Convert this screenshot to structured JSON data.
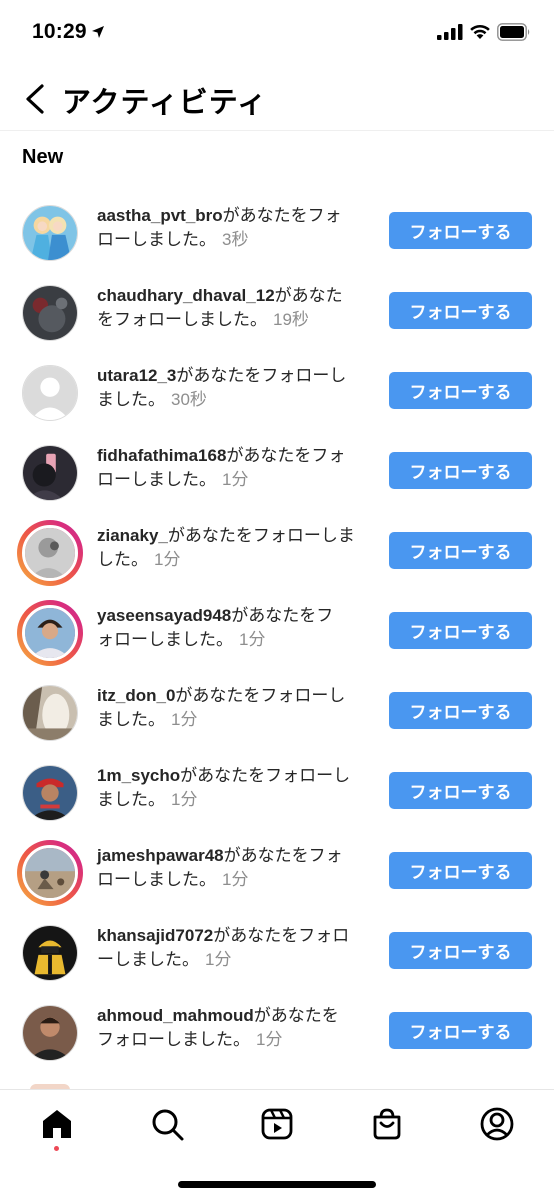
{
  "status_bar": {
    "time": "10:29"
  },
  "header": {
    "title": "アクティビティ"
  },
  "section": {
    "title": "New"
  },
  "follow_label": "フォローする",
  "notifications": [
    {
      "username": "aastha_pvt_bro",
      "line1_suffix": "があなたをフォ",
      "line2": "ローしました。",
      "time": "3秒"
    },
    {
      "username": "chaudhary_dhaval_12",
      "line1_suffix": "があなた",
      "line2": "をフォローしました。",
      "time": "19秒"
    },
    {
      "username": "utara12_3",
      "line1_suffix": "があなたをフォローし",
      "line2": "ました。",
      "time": "30秒"
    },
    {
      "username": "fidhafathima168",
      "line1_suffix": "があなたをフォ",
      "line2": "ローしました。",
      "time": "1分"
    },
    {
      "username": "zianaky_",
      "line1_suffix": "があなたをフォローしま",
      "line2": "した。",
      "time": "1分"
    },
    {
      "username": "yaseensayad948",
      "line1_suffix": "があなたをフ",
      "line2": "ォローしました。",
      "time": "1分"
    },
    {
      "username": "itz_don_0",
      "line1_suffix": "があなたをフォローし",
      "line2": "ました。",
      "time": "1分"
    },
    {
      "username": "1m_sycho",
      "line1_suffix": "があなたをフォローし",
      "line2": "ました。",
      "time": "1分"
    },
    {
      "username": "jameshpawar48",
      "line1_suffix": "があなたをフォ",
      "line2": "ローしました。",
      "time": "1分"
    },
    {
      "username": "khansajid7072",
      "line1_suffix": "があなたをフォロ",
      "line2": "ーしました。",
      "time": "1分"
    },
    {
      "username": "ahmoud_mahmoud",
      "line1_suffix": "があなたを",
      "line2": "フォローしました。",
      "time": "1分"
    }
  ],
  "tabs": [
    "home-icon",
    "search-icon",
    "reels-icon",
    "shop-icon",
    "profile-icon"
  ],
  "colors": {
    "follow_button": "#4a97f0",
    "unread_dot": "#ed4956",
    "story_ring": "#d92e7c"
  }
}
